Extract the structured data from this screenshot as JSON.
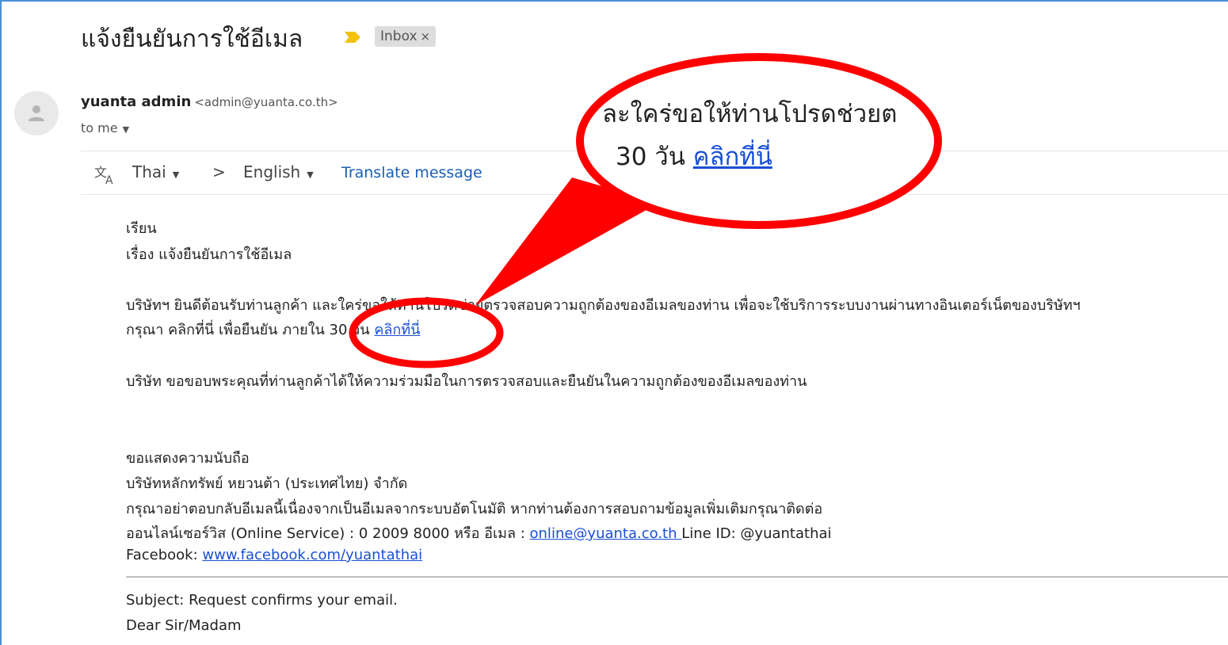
{
  "email": {
    "subject": "แจ้งยืนยันการใช้อีเมล",
    "label": "Inbox",
    "label_close": "×",
    "sender_name": "yuanta admin",
    "sender_address": "<admin@yuanta.co.th>",
    "recipient": "to me"
  },
  "translate": {
    "from_lang": "Thai",
    "arrow": ">",
    "to_lang": "English",
    "action": "Translate message"
  },
  "body": {
    "greeting": "เรียน",
    "topic": "เรื่อง แจ้งยืนยันการใช้อีเมล",
    "para1": "บริษัทฯ ยินดีต้อนรับท่านลูกค้า และใคร่ขอให้ท่านโปรดช่วยตรวจสอบความถูกต้องของอีเมลของท่าน เพื่อจะใช้บริการระบบงานผ่านทางอินเตอร์เน็ตของบริษัทฯ",
    "para2_prefix": "กรุณา คลิกที่นี่ เพื่อยืนยัน ภายใน 30 วัน ",
    "para2_link": "คลิกที่นี่",
    "para3": "บริษัท ขอขอบพระคุณที่ท่านลูกค้าได้ให้ความร่วมมือในการตรวจสอบและยืนยันในความถูกต้องของอีเมลของท่าน",
    "closing": "ขอแสดงความนับถือ",
    "company": "บริษัทหลักทรัพย์ หยวนต้า (ประเทศไทย) จำกัด",
    "noreply": "กรุณาอย่าตอบกลับอีเมลนี้เนื่องจากเป็นอีเมลจากระบบอัตโนมัติ หากท่านต้องการสอบถามข้อมูลเพิ่มเติมกรุณาติดต่อ",
    "contact_prefix": "ออนไลน์เซอร์วิส (Online Service) : 0 2009 8000 หรือ อีเมล : ",
    "contact_email": "online@yuanta.co.th ",
    "contact_suffix": "Line ID: @yuantathai",
    "facebook_prefix": "Facebook: ",
    "facebook_link": "www.facebook.com/yuantathai",
    "en_subject": "Subject: Request confirms your email.",
    "en_greeting": "Dear Sir/Madam"
  },
  "callout": {
    "line1": "ละใคร่ขอให้ท่านโปรดช่วยต",
    "line2_prefix": "30 วัน ",
    "line2_link": "คลิกที่นี่"
  },
  "colors": {
    "annotation": "#ff0000",
    "link": "#1a4fd6",
    "important_marker": "#f4c20d"
  }
}
